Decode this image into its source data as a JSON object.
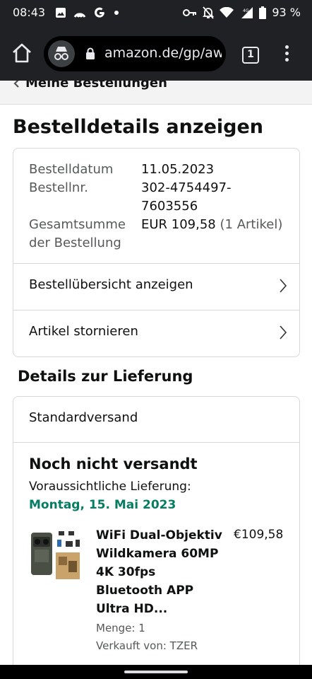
{
  "status_bar": {
    "time": "08:43",
    "battery": "93 %",
    "network": "4G",
    "left_icons": [
      "image-icon",
      "hotspot-icon",
      "google-icon",
      "dot-icon"
    ],
    "right_icons": [
      "vpn-key-icon",
      "mute-icon",
      "wifi-icon",
      "signal-icon"
    ]
  },
  "browser": {
    "url": "amazon.de/gp/aw",
    "tab_count": "1"
  },
  "breadcrumb": {
    "label": "Meine Bestellungen"
  },
  "page": {
    "title": "Bestelldetails anzeigen"
  },
  "order": {
    "date_label": "Bestelldatum",
    "date_value": "11.05.2023",
    "number_label": "Bestellnr.",
    "number_value_line1": "302-4754497-",
    "number_value_line2": "7603556",
    "total_label_line1": "Gesamtsumme",
    "total_label_line2": "der Bestellung",
    "total_value": "EUR 109,58",
    "total_count": "(1 Artikel)",
    "link_overview": "Bestellübersicht anzeigen",
    "link_cancel": "Artikel stornieren"
  },
  "delivery": {
    "section_title": "Details zur Lieferung",
    "shipping_method": "Standardversand",
    "status": "Noch nicht versandt",
    "eta_label": "Voraussichtliche Lieferung:",
    "eta_date": "Montag, 15. Mai 2023",
    "eta_color": "#067d62"
  },
  "product": {
    "title_lines": [
      "WiFi Dual-Objektiv",
      "Wildkamera 60MP",
      "4K 30fps",
      "Bluetooth APP",
      "Ultra HD..."
    ],
    "price": "€109,58",
    "quantity": "Menge: 1",
    "seller": "Verkauft von: TZER"
  }
}
